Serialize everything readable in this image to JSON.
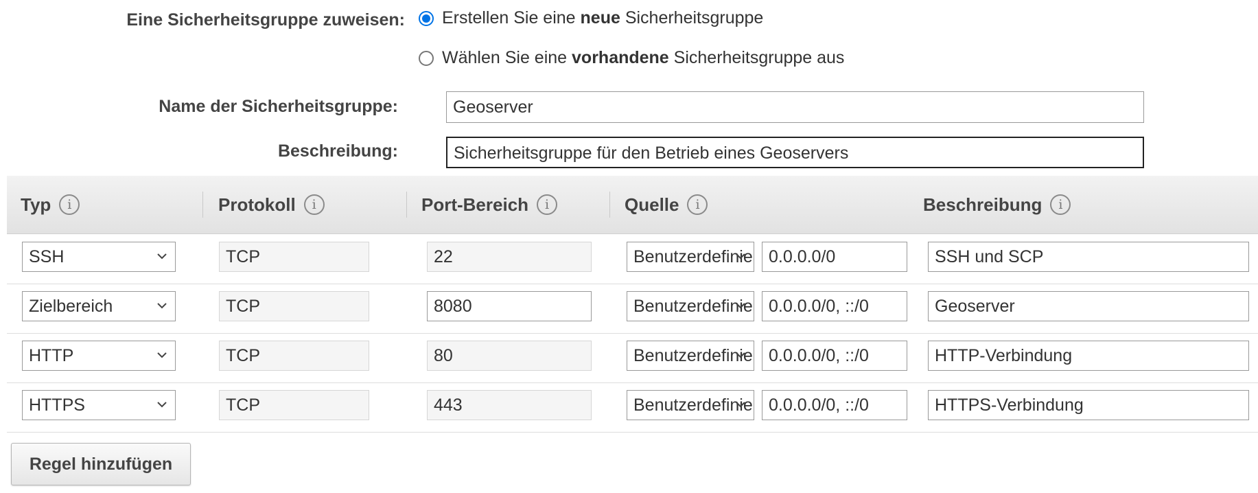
{
  "assign": {
    "label": "Eine Sicherheitsgruppe zuweisen:",
    "option_new_prefix": "Erstellen Sie eine ",
    "option_new_bold": "neue",
    "option_new_suffix": " Sicherheitsgruppe",
    "option_existing_prefix": "Wählen Sie eine ",
    "option_existing_bold": "vorhandene",
    "option_existing_suffix": " Sicherheitsgruppe aus",
    "selected": "new"
  },
  "name_field": {
    "label": "Name der Sicherheitsgruppe:",
    "value": "Geoserver"
  },
  "description_field": {
    "label": "Beschreibung:",
    "value": "Sicherheitsgruppe für den Betrieb eines Geoservers"
  },
  "table": {
    "headers": {
      "type": "Typ",
      "protocol": "Protokoll",
      "port_range": "Port-Bereich",
      "source": "Quelle",
      "description": "Beschreibung"
    },
    "info_glyph": "i",
    "rows": [
      {
        "type": "SSH",
        "protocol": "TCP",
        "port": "22",
        "port_editable": false,
        "source_type": "Benutzerdefiniert",
        "source": "0.0.0.0/0",
        "description": "SSH und SCP"
      },
      {
        "type": "Zielbereich",
        "protocol": "TCP",
        "port": "8080",
        "port_editable": true,
        "source_type": "Benutzerdefiniert",
        "source": "0.0.0.0/0, ::/0",
        "description": "Geoserver"
      },
      {
        "type": "HTTP",
        "protocol": "TCP",
        "port": "80",
        "port_editable": false,
        "source_type": "Benutzerdefiniert",
        "source": "0.0.0.0/0, ::/0",
        "description": "HTTP-Verbindung"
      },
      {
        "type": "HTTPS",
        "protocol": "TCP",
        "port": "443",
        "port_editable": false,
        "source_type": "Benutzerdefiniert",
        "source": "0.0.0.0/0, ::/0",
        "description": "HTTPS-Verbindung"
      }
    ]
  },
  "add_rule_button": "Regel hinzufügen",
  "colors": {
    "accent": "#0073e6",
    "header_bg": "#e8e8e8",
    "readonly_bg": "#f5f5f5"
  },
  "icons": {
    "info": "info-icon",
    "dropdown": "chevron-down-icon"
  }
}
